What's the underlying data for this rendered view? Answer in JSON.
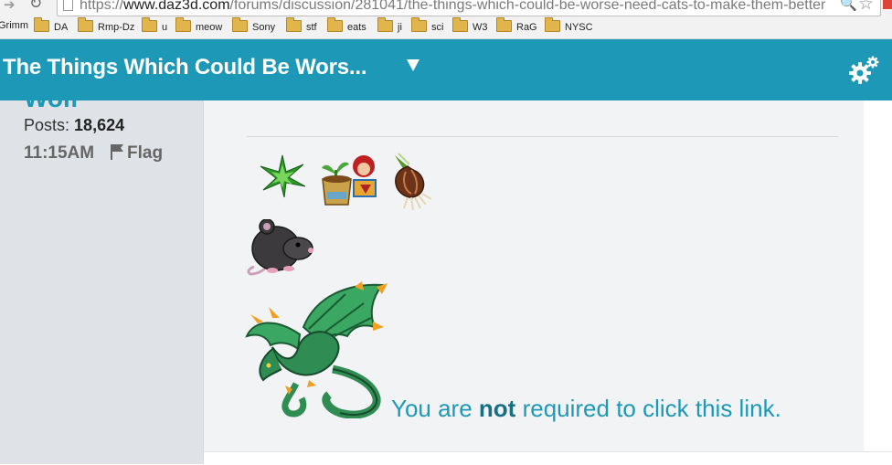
{
  "browser": {
    "url_prefix": "https://",
    "url_host": "www.daz3d.com",
    "url_path": "/forums/discussion/281041/the-things-which-could-be-worse-need-cats-to-make-them-better",
    "bookmarks": [
      {
        "label": "Grimm",
        "folder": false
      },
      {
        "label": "DA",
        "folder": true
      },
      {
        "label": "Rmp-Dz",
        "folder": true
      },
      {
        "label": "u",
        "folder": true
      },
      {
        "label": "meow",
        "folder": true
      },
      {
        "label": "Sony",
        "folder": true
      },
      {
        "label": "stf",
        "folder": true
      },
      {
        "label": "eats",
        "folder": true
      },
      {
        "label": "ji",
        "folder": true
      },
      {
        "label": "sci",
        "folder": true
      },
      {
        "label": "W3",
        "folder": true
      },
      {
        "label": "RaG",
        "folder": true
      },
      {
        "label": "NYSC",
        "folder": true
      }
    ]
  },
  "header": {
    "title": "The Things Which Could Be Wors...",
    "accent_color": "#1d99b7",
    "settings_icon": "gears-icon"
  },
  "author": {
    "name": "Wolf",
    "posts_label": "Posts:",
    "posts_count": "18,624",
    "time": "11:15AM",
    "flag_label": "Flag"
  },
  "post": {
    "sprites": [
      "green-spiky-plant",
      "potted-seedling-and-red-haired-doll",
      "onion-bulb",
      "gray-rat",
      "green-dragon"
    ],
    "text_before": "You are",
    "text_bold": "not",
    "text_after": "required to click this link.",
    "link_color": "#1d99b7"
  }
}
